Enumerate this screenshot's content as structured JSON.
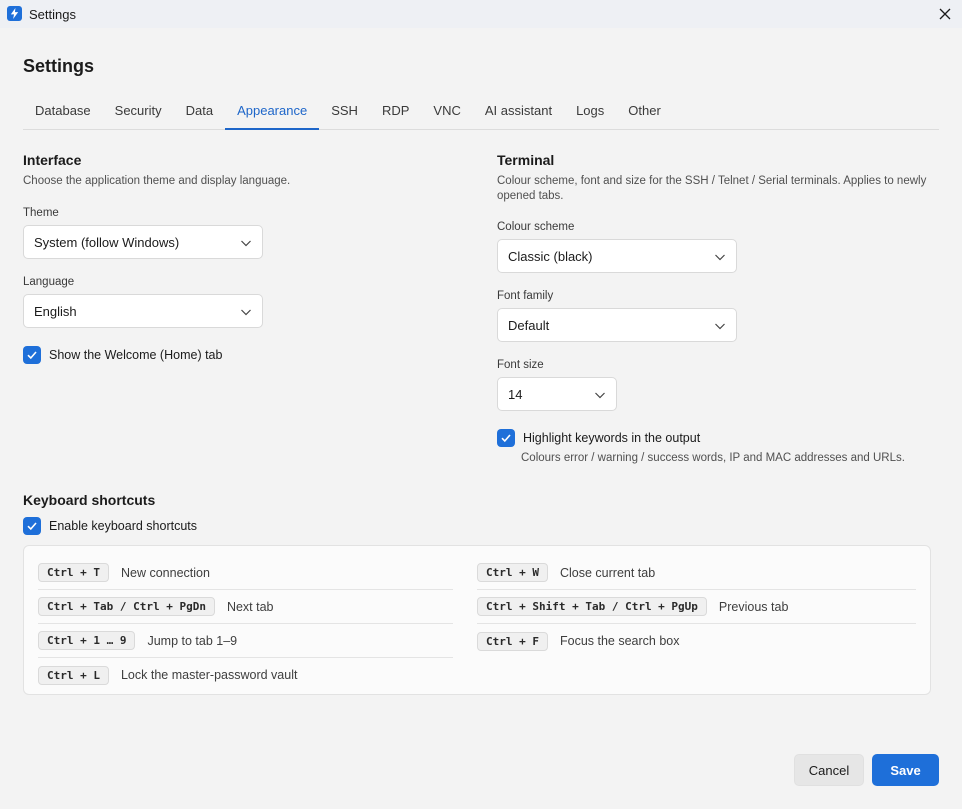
{
  "window": {
    "title": "Settings"
  },
  "page": {
    "title": "Settings"
  },
  "tabs": [
    {
      "label": "Database"
    },
    {
      "label": "Security"
    },
    {
      "label": "Data"
    },
    {
      "label": "Appearance",
      "active": true
    },
    {
      "label": "SSH"
    },
    {
      "label": "RDP"
    },
    {
      "label": "VNC"
    },
    {
      "label": "AI assistant"
    },
    {
      "label": "Logs"
    },
    {
      "label": "Other"
    }
  ],
  "interface": {
    "title": "Interface",
    "subtitle": "Choose the application theme and display language.",
    "theme_label": "Theme",
    "theme_value": "System (follow Windows)",
    "language_label": "Language",
    "language_value": "English",
    "welcome_tab_label": "Show the Welcome (Home) tab",
    "welcome_tab_checked": true
  },
  "terminal": {
    "title": "Terminal",
    "subtitle_line1": "Colour scheme, font and size for the SSH / Telnet / Serial terminals. Applies to newly",
    "subtitle_line2": "opened tabs.",
    "scheme_label": "Colour scheme",
    "scheme_value": "Classic (black)",
    "font_family_label": "Font family",
    "font_family_value": "Default",
    "font_size_label": "Font size",
    "font_size_value": "14",
    "highlight_label": "Highlight keywords in the output",
    "highlight_checked": true,
    "highlight_help": "Colours error / warning / success words, IP and MAC addresses and URLs."
  },
  "shortcuts": {
    "title": "Keyboard shortcuts",
    "enable_label": "Enable keyboard shortcuts",
    "enable_checked": true,
    "left": [
      {
        "keys": "Ctrl + T",
        "desc": "New connection"
      },
      {
        "keys": "Ctrl + Tab / Ctrl + PgDn",
        "desc": "Next tab"
      },
      {
        "keys": "Ctrl + 1 … 9",
        "desc": "Jump to tab 1–9"
      },
      {
        "keys": "Ctrl + L",
        "desc": "Lock the master-password vault"
      }
    ],
    "right": [
      {
        "keys": "Ctrl + W",
        "desc": "Close current tab"
      },
      {
        "keys": "Ctrl + Shift + Tab / Ctrl + PgUp",
        "desc": "Previous tab"
      },
      {
        "keys": "Ctrl + F",
        "desc": "Focus the search box"
      }
    ]
  },
  "footer": {
    "cancel_label": "Cancel",
    "save_label": "Save"
  },
  "colors": {
    "accent": "#1e6fd9",
    "tab_active": "#1e66c9",
    "background": "#f3f3f3"
  },
  "icons": {
    "app": "lightning-bolt-icon",
    "close": "close-icon",
    "dropdown": "chevron-down-icon",
    "check": "checkmark-icon"
  }
}
